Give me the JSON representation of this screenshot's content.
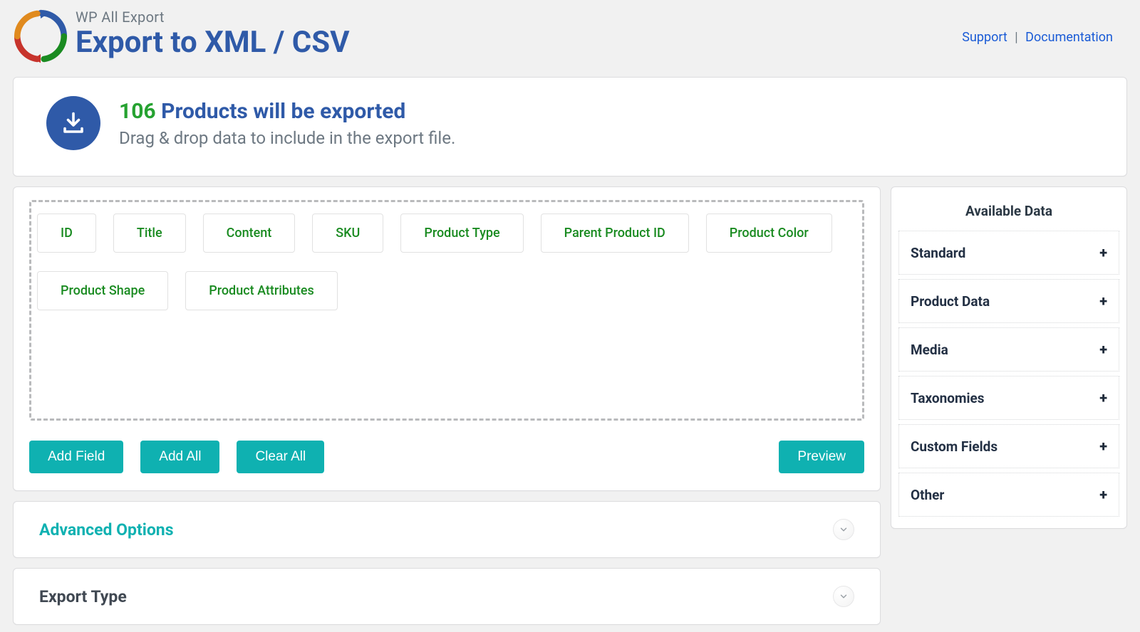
{
  "header": {
    "subtitle": "WP All Export",
    "title": "Export to XML / CSV",
    "links": {
      "support": "Support",
      "documentation": "Documentation"
    }
  },
  "summary": {
    "count": "106",
    "headline_suffix": "Products will be exported",
    "subline": "Drag & drop data to include in the export file."
  },
  "builder": {
    "fields": [
      "ID",
      "Title",
      "Content",
      "SKU",
      "Product Type",
      "Parent Product ID",
      "Product Color",
      "Product Shape",
      "Product Attributes"
    ],
    "buttons": {
      "add_field": "Add Field",
      "add_all": "Add All",
      "clear_all": "Clear All",
      "preview": "Preview"
    }
  },
  "sections": {
    "advanced": "Advanced Options",
    "export_type": "Export Type"
  },
  "sidebar": {
    "title": "Available Data",
    "groups": [
      "Standard",
      "Product Data",
      "Media",
      "Taxonomies",
      "Custom Fields",
      "Other"
    ]
  }
}
